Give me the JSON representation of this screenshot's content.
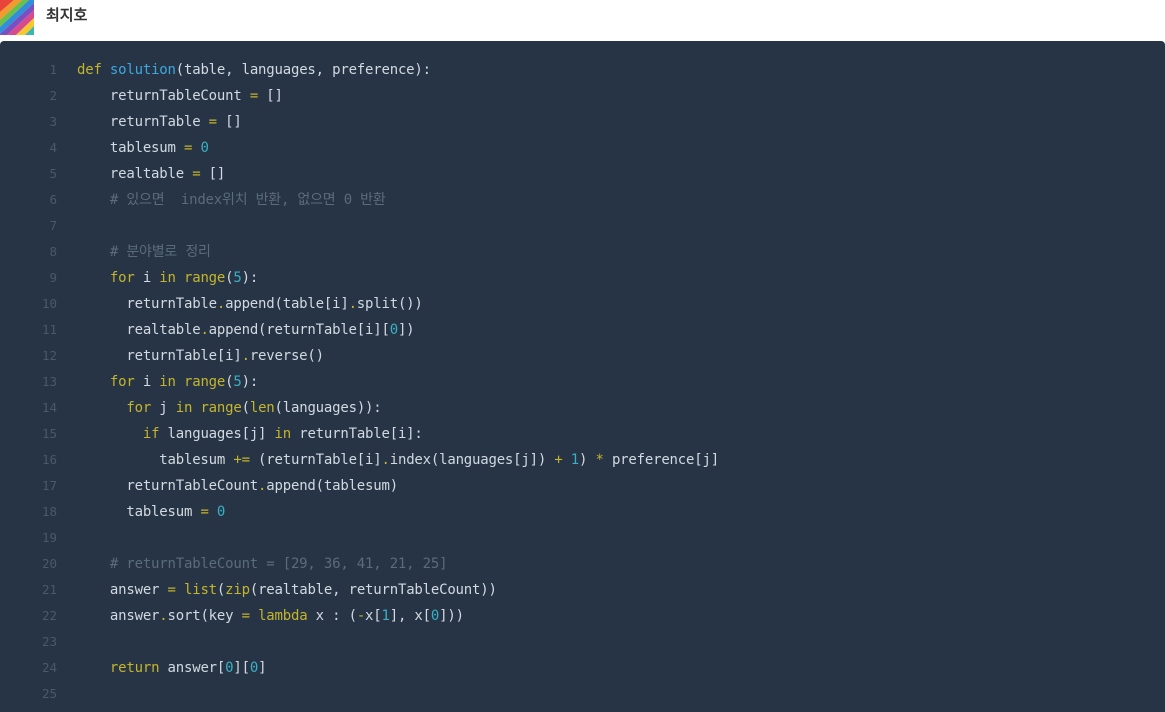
{
  "header": {
    "author": "최지호"
  },
  "colors": {
    "panel_bg": "#263445",
    "keyword": "#c5b52b",
    "function_name": "#3fa7e0",
    "number": "#3ab0c4",
    "comment": "#5b6b7c",
    "text": "#d2d9e0",
    "line_number": "#4a5968"
  },
  "code": {
    "language": "python",
    "lines": [
      {
        "n": "1",
        "tokens": [
          [
            "kw",
            "def"
          ],
          [
            "pn",
            " "
          ],
          [
            "fn",
            "solution"
          ],
          [
            "pn",
            "(table, languages, preference):"
          ]
        ]
      },
      {
        "n": "2",
        "tokens": [
          [
            "pn",
            "    returnTableCount "
          ],
          [
            "op",
            "="
          ],
          [
            "pn",
            " []"
          ]
        ]
      },
      {
        "n": "3",
        "tokens": [
          [
            "pn",
            "    returnTable "
          ],
          [
            "op",
            "="
          ],
          [
            "pn",
            " []"
          ]
        ]
      },
      {
        "n": "4",
        "tokens": [
          [
            "pn",
            "    tablesum "
          ],
          [
            "op",
            "="
          ],
          [
            "pn",
            " "
          ],
          [
            "num",
            "0"
          ]
        ]
      },
      {
        "n": "5",
        "tokens": [
          [
            "pn",
            "    realtable "
          ],
          [
            "op",
            "="
          ],
          [
            "pn",
            " []"
          ]
        ]
      },
      {
        "n": "6",
        "tokens": [
          [
            "cm",
            "    # 있으면  index위치 반환, 없으면 0 반환"
          ]
        ]
      },
      {
        "n": "7",
        "tokens": []
      },
      {
        "n": "8",
        "tokens": [
          [
            "cm",
            "    # 분야별로 정리"
          ]
        ]
      },
      {
        "n": "9",
        "tokens": [
          [
            "pn",
            "    "
          ],
          [
            "kw",
            "for"
          ],
          [
            "pn",
            " i "
          ],
          [
            "kw",
            "in"
          ],
          [
            "pn",
            " "
          ],
          [
            "bi",
            "range"
          ],
          [
            "pn",
            "("
          ],
          [
            "num",
            "5"
          ],
          [
            "pn",
            "):"
          ]
        ]
      },
      {
        "n": "10",
        "tokens": [
          [
            "pn",
            "      returnTable"
          ],
          [
            "op",
            "."
          ],
          [
            "pn",
            "append(table[i]"
          ],
          [
            "op",
            "."
          ],
          [
            "pn",
            "split())"
          ]
        ]
      },
      {
        "n": "11",
        "tokens": [
          [
            "pn",
            "      realtable"
          ],
          [
            "op",
            "."
          ],
          [
            "pn",
            "append(returnTable[i]["
          ],
          [
            "num",
            "0"
          ],
          [
            "pn",
            "])"
          ]
        ]
      },
      {
        "n": "12",
        "tokens": [
          [
            "pn",
            "      returnTable[i]"
          ],
          [
            "op",
            "."
          ],
          [
            "pn",
            "reverse()"
          ]
        ]
      },
      {
        "n": "13",
        "tokens": [
          [
            "pn",
            "    "
          ],
          [
            "kw",
            "for"
          ],
          [
            "pn",
            " i "
          ],
          [
            "kw",
            "in"
          ],
          [
            "pn",
            " "
          ],
          [
            "bi",
            "range"
          ],
          [
            "pn",
            "("
          ],
          [
            "num",
            "5"
          ],
          [
            "pn",
            "):"
          ]
        ]
      },
      {
        "n": "14",
        "tokens": [
          [
            "pn",
            "      "
          ],
          [
            "kw",
            "for"
          ],
          [
            "pn",
            " j "
          ],
          [
            "kw",
            "in"
          ],
          [
            "pn",
            " "
          ],
          [
            "bi",
            "range"
          ],
          [
            "pn",
            "("
          ],
          [
            "bi",
            "len"
          ],
          [
            "pn",
            "(languages)):"
          ]
        ]
      },
      {
        "n": "15",
        "tokens": [
          [
            "pn",
            "        "
          ],
          [
            "kw",
            "if"
          ],
          [
            "pn",
            " languages[j] "
          ],
          [
            "kw",
            "in"
          ],
          [
            "pn",
            " returnTable[i]:"
          ]
        ]
      },
      {
        "n": "16",
        "tokens": [
          [
            "pn",
            "          tablesum "
          ],
          [
            "op",
            "+="
          ],
          [
            "pn",
            " (returnTable[i]"
          ],
          [
            "op",
            "."
          ],
          [
            "pn",
            "index(languages[j]) "
          ],
          [
            "op",
            "+"
          ],
          [
            "pn",
            " "
          ],
          [
            "num",
            "1"
          ],
          [
            "pn",
            ") "
          ],
          [
            "op",
            "*"
          ],
          [
            "pn",
            " preference[j]"
          ]
        ]
      },
      {
        "n": "17",
        "tokens": [
          [
            "pn",
            "      returnTableCount"
          ],
          [
            "op",
            "."
          ],
          [
            "pn",
            "append(tablesum)"
          ]
        ]
      },
      {
        "n": "18",
        "tokens": [
          [
            "pn",
            "      tablesum "
          ],
          [
            "op",
            "="
          ],
          [
            "pn",
            " "
          ],
          [
            "num",
            "0"
          ]
        ]
      },
      {
        "n": "19",
        "tokens": []
      },
      {
        "n": "20",
        "tokens": [
          [
            "cm",
            "    # returnTableCount = [29, 36, 41, 21, 25]"
          ]
        ]
      },
      {
        "n": "21",
        "tokens": [
          [
            "pn",
            "    answer "
          ],
          [
            "op",
            "="
          ],
          [
            "pn",
            " "
          ],
          [
            "bi",
            "list"
          ],
          [
            "pn",
            "("
          ],
          [
            "bi",
            "zip"
          ],
          [
            "pn",
            "(realtable, returnTableCount))"
          ]
        ]
      },
      {
        "n": "22",
        "tokens": [
          [
            "pn",
            "    answer"
          ],
          [
            "op",
            "."
          ],
          [
            "pn",
            "sort(key "
          ],
          [
            "op",
            "="
          ],
          [
            "pn",
            " "
          ],
          [
            "kw",
            "lambda"
          ],
          [
            "pn",
            " x : ("
          ],
          [
            "op",
            "-"
          ],
          [
            "pn",
            "x["
          ],
          [
            "num",
            "1"
          ],
          [
            "pn",
            "], x["
          ],
          [
            "num",
            "0"
          ],
          [
            "pn",
            "]))"
          ]
        ]
      },
      {
        "n": "23",
        "tokens": []
      },
      {
        "n": "24",
        "tokens": [
          [
            "pn",
            "    "
          ],
          [
            "kw",
            "return"
          ],
          [
            "pn",
            " answer["
          ],
          [
            "num",
            "0"
          ],
          [
            "pn",
            "]["
          ],
          [
            "num",
            "0"
          ],
          [
            "pn",
            "]"
          ]
        ]
      },
      {
        "n": "25",
        "tokens": []
      }
    ]
  }
}
